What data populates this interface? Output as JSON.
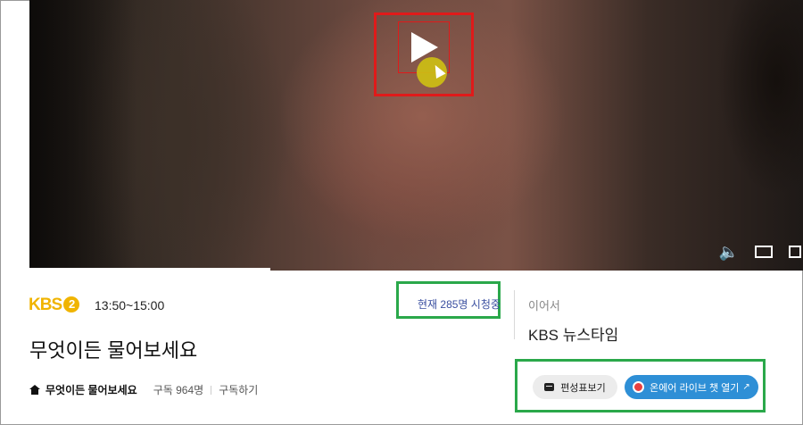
{
  "player": {
    "controls": [
      "volume-icon",
      "theater-icon",
      "fullscreen-icon"
    ]
  },
  "channel": {
    "logo_text": "KBS",
    "logo_channel": "2",
    "time": "13:50~15:00",
    "brand_color": "#f0b400"
  },
  "program": {
    "title": "무엇이든 물어보세요",
    "name": "무엇이든 물어보세요",
    "subscribers": "구독 964명",
    "subscribe_label": "구독하기"
  },
  "viewers": {
    "text": "현재 285명 시청중"
  },
  "next": {
    "label": "이어서",
    "title": "KBS 뉴스타임"
  },
  "buttons": {
    "schedule": "편성표보기",
    "live_chat": "온에어 라이브 챗 열기"
  },
  "colors": {
    "highlight_red": "#e01a1a",
    "highlight_green": "#2aa84a",
    "live_button": "#2e8fd6"
  }
}
